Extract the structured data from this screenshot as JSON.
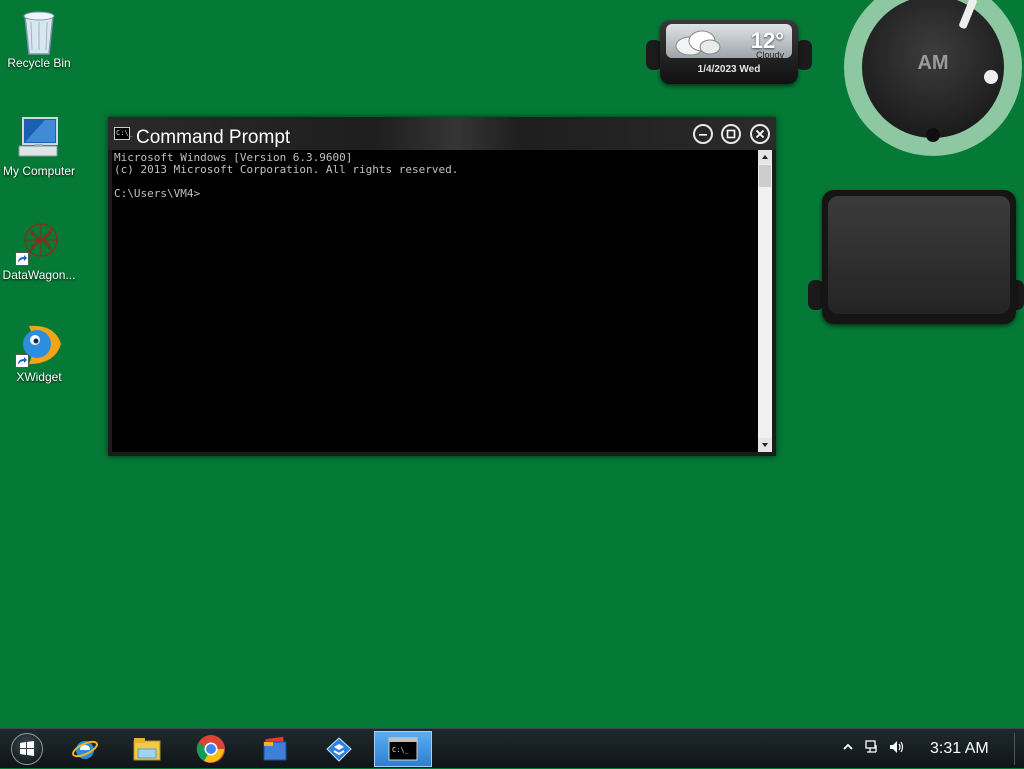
{
  "desktop": {
    "icons": [
      {
        "label": "Recycle Bin",
        "icon": "recycle-bin-icon"
      },
      {
        "label": "My Computer",
        "icon": "computer-icon"
      },
      {
        "label": "DataWagon...",
        "icon": "datawagon-icon"
      },
      {
        "label": "XWidget",
        "icon": "xwidget-icon"
      }
    ]
  },
  "weather_widget": {
    "temperature": "12°",
    "condition": "Cloudy",
    "date": "1/4/2023 Wed"
  },
  "clock_widget": {
    "ampm": "AM"
  },
  "cmd_window": {
    "title": "Command Prompt",
    "icon_text": "C:\\_",
    "lines": [
      "Microsoft Windows [Version 6.3.9600]",
      "(c) 2013 Microsoft Corporation. All rights reserved.",
      "",
      "C:\\Users\\VM4>"
    ]
  },
  "taskbar": {
    "items": [
      {
        "icon": "internet-explorer-icon"
      },
      {
        "icon": "file-explorer-icon"
      },
      {
        "icon": "chrome-icon"
      },
      {
        "icon": "file-manager-icon"
      },
      {
        "icon": "app-icon"
      },
      {
        "icon": "command-prompt-icon",
        "active": true
      }
    ],
    "time": "3:31 AM"
  },
  "colors": {
    "desktop_bg": "#047a36",
    "taskbar_active": "#3d8fdb"
  }
}
